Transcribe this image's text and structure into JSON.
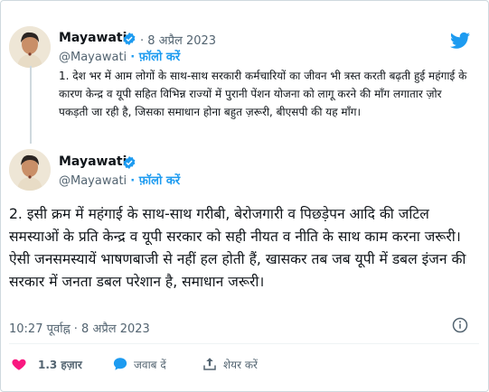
{
  "tweet_parent": {
    "author_name": "Mayawati",
    "date": "· 8 अप्रैल 2023",
    "handle": "@Mayawati",
    "follow_label": "· फ़ॉलो करें",
    "text": "1. देश भर में आम लोगों के साथ-साथ सरकारी कर्मचारियों का जीवन भी त्रस्त करती बढ़ती हुई महंगाई के कारण केन्द्र व यूपी सहित विभिन्न राज्यों में पुरानी पेंशन योजना को लागू करने की माँग लगातार ज़ोर पकड़ती जा रही है, जिसका समाधान होना बहुत ज़रूरी, बीएसपी की यह माँग।"
  },
  "tweet_main": {
    "author_name": "Mayawati",
    "handle": "@Mayawati",
    "follow_label": "· फ़ॉलो करें",
    "text": "2. इसी क्रम में महंगाई के साथ-साथ गरीबी, बेरोजगारी व पिछड़ेपन आदि की जटिल समस्याओं के प्रति केन्द्र व यूपी सरकार को सही नीयत व नीति के साथ काम करना जरूरी। ऐसी जनसमस्यायें भाषणबाजी से नहीं हल होती हैं, खासकर तब जब यूपी में डबल इंजन की सरकार में जनता डबल परेशान है, समाधान जरूरी।",
    "timestamp": "10:27 पूर्वाह्न · 8 अप्रैल 2023"
  },
  "actions": {
    "like_count": "1.3 हज़ार",
    "reply_label": "जवाब दें",
    "share_label": "शेयर करें"
  },
  "colors": {
    "accent": "#1d9bf0",
    "like": "#f91880",
    "text": "#0f1419",
    "muted": "#536471"
  },
  "icons": [
    "twitter-bird-icon",
    "verified-badge-icon",
    "info-icon",
    "heart-icon",
    "reply-icon",
    "share-icon"
  ]
}
